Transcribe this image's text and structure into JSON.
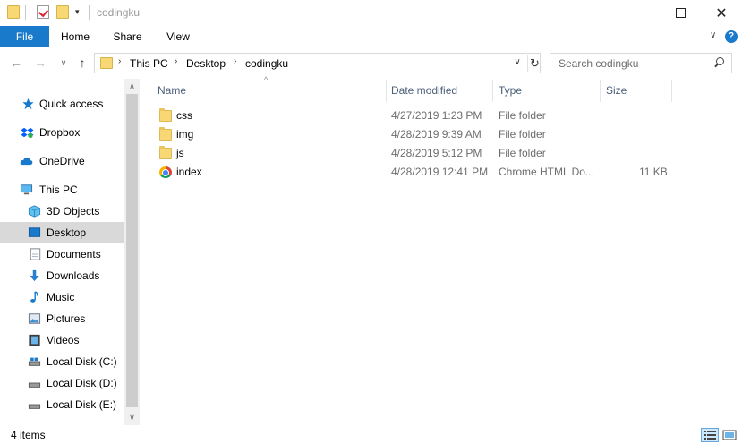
{
  "window": {
    "title": "codingku",
    "controls": {
      "minimize": "—",
      "maximize": "☐",
      "close": "✕"
    }
  },
  "ribbon": {
    "tabs": [
      "File",
      "Home",
      "Share",
      "View"
    ],
    "help_label": "?"
  },
  "address": {
    "crumbs": [
      "This PC",
      "Desktop",
      "codingku"
    ]
  },
  "search": {
    "placeholder": "Search codingku"
  },
  "nav": {
    "items": [
      {
        "label": "Quick access",
        "icon": "star-icon",
        "selected": false
      },
      {
        "label": "Dropbox",
        "icon": "dropbox-icon",
        "selected": false
      },
      {
        "label": "OneDrive",
        "icon": "cloud-icon",
        "selected": false
      },
      {
        "label": "This PC",
        "icon": "computer-icon",
        "selected": false
      },
      {
        "label": "3D Objects",
        "icon": "cube-icon",
        "selected": false
      },
      {
        "label": "Desktop",
        "icon": "desktop-icon",
        "selected": true
      },
      {
        "label": "Documents",
        "icon": "document-icon",
        "selected": false
      },
      {
        "label": "Downloads",
        "icon": "download-icon",
        "selected": false
      },
      {
        "label": "Music",
        "icon": "music-icon",
        "selected": false
      },
      {
        "label": "Pictures",
        "icon": "picture-icon",
        "selected": false
      },
      {
        "label": "Videos",
        "icon": "video-icon",
        "selected": false
      },
      {
        "label": "Local Disk (C:)",
        "icon": "drive-icon",
        "selected": false
      },
      {
        "label": "Local Disk (D:)",
        "icon": "drive-icon",
        "selected": false
      },
      {
        "label": "Local Disk (E:)",
        "icon": "drive-icon",
        "selected": false
      }
    ]
  },
  "columns": {
    "name": "Name",
    "date": "Date modified",
    "type": "Type",
    "size": "Size"
  },
  "files": [
    {
      "name": "css",
      "date": "4/27/2019 1:23 PM",
      "type": "File folder",
      "size": "",
      "icon": "folder-icon"
    },
    {
      "name": "img",
      "date": "4/28/2019 9:39 AM",
      "type": "File folder",
      "size": "",
      "icon": "folder-icon"
    },
    {
      "name": "js",
      "date": "4/28/2019 5:12 PM",
      "type": "File folder",
      "size": "",
      "icon": "folder-icon"
    },
    {
      "name": "index",
      "date": "4/28/2019 12:41 PM",
      "type": "Chrome HTML Do...",
      "size": "11 KB",
      "icon": "chrome-icon"
    }
  ],
  "status": {
    "text": "4 items"
  },
  "colors": {
    "accent": "#1979ca",
    "header_text": "#4c607a",
    "selected_nav": "#d9d9d9"
  }
}
